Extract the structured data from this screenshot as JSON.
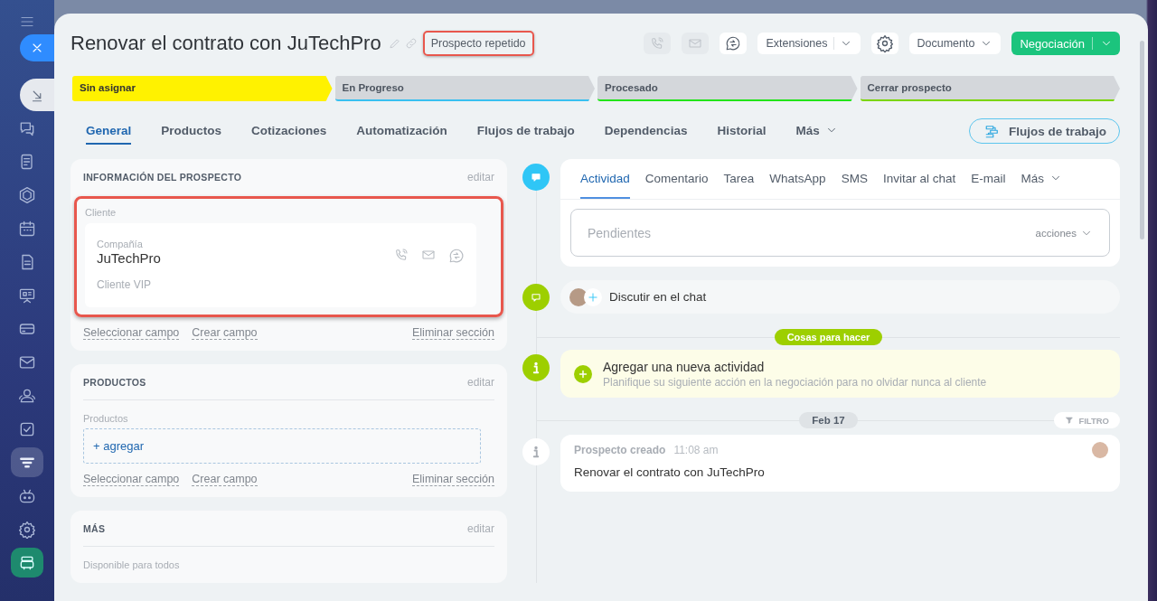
{
  "sidebar": {
    "items": [
      {
        "kind": "chat",
        "selected": false
      },
      {
        "kind": "news",
        "selected": false
      },
      {
        "kind": "hexagon",
        "selected": false
      },
      {
        "kind": "calendar",
        "selected": false
      },
      {
        "kind": "document",
        "selected": false
      },
      {
        "kind": "board",
        "selected": false
      },
      {
        "kind": "card",
        "selected": false
      },
      {
        "kind": "mail",
        "selected": false
      },
      {
        "kind": "people",
        "selected": false
      },
      {
        "kind": "check",
        "selected": false
      },
      {
        "kind": "filter",
        "selected": true
      },
      {
        "kind": "robot",
        "selected": false
      },
      {
        "kind": "gear",
        "selected": false
      }
    ]
  },
  "header": {
    "title": "Renovar el contrato con JuTechPro",
    "badge": "Prospecto repetido",
    "buttons": [
      {
        "kind": "phone",
        "disabled": true
      },
      {
        "kind": "mail",
        "disabled": true
      },
      {
        "kind": "chat",
        "disabled": false
      }
    ],
    "extensions": "Extensiones",
    "document": "Documento",
    "primary": "Negociación"
  },
  "stages": [
    {
      "label": "Sin asignar",
      "color": "#fff200",
      "selected": true
    },
    {
      "label": "En Progreso",
      "color": "#39c0f0",
      "selected": false
    },
    {
      "label": "Procesado",
      "color": "#22e41a",
      "selected": false
    },
    {
      "label": "Cerrar prospecto",
      "color": "#7bd500",
      "selected": false
    }
  ],
  "tabs": [
    {
      "label": "General",
      "selected": true
    },
    {
      "label": "Productos",
      "selected": false
    },
    {
      "label": "Cotizaciones",
      "selected": false
    },
    {
      "label": "Automatización",
      "selected": false
    },
    {
      "label": "Flujos de trabajo",
      "selected": false
    },
    {
      "label": "Dependencias",
      "selected": false
    },
    {
      "label": "Historial",
      "selected": false
    },
    {
      "label": "Más",
      "selected": false
    }
  ],
  "workflow_button": "Flujos de trabajo",
  "sections": [
    {
      "kind": "client",
      "title": "INFORMACIÓN DEL PROSPECTO",
      "edit": "editar",
      "field_label": "Cliente",
      "client": {
        "caption": "Compañía",
        "name": "JuTechPro",
        "note": "Cliente VIP"
      },
      "links": [
        "Seleccionar campo",
        "Crear campo"
      ],
      "remove": "Eliminar sección"
    },
    {
      "kind": "products",
      "title": "PRODUCTOS",
      "edit": "editar",
      "field_label": "Productos",
      "add": "+ agregar",
      "links": [
        "Seleccionar campo",
        "Crear campo"
      ],
      "remove": "Eliminar sección"
    },
    {
      "kind": "text",
      "title": "MÁS",
      "edit": "editar",
      "field_label": "Disponible para todos"
    }
  ],
  "activity": {
    "tabs": [
      {
        "label": "Actividad",
        "selected": true
      },
      {
        "label": "Comentario",
        "selected": false
      },
      {
        "label": "Tarea",
        "selected": false
      },
      {
        "label": "WhatsApp",
        "selected": false
      },
      {
        "label": "SMS",
        "selected": false
      },
      {
        "label": "Invitar al chat",
        "selected": false
      },
      {
        "label": "E-mail",
        "selected": false
      },
      {
        "label": "Más",
        "selected": false
      }
    ],
    "placeholder": "Pendientes",
    "actions": "acciones"
  },
  "chat": "Discutir en el chat",
  "todo_badge": "Cosas para hacer",
  "new_activity": {
    "title": "Agregar una nueva actividad",
    "subtitle": "Planifique su siguiente acción en la negociación para no olvidar nunca al cliente"
  },
  "date": "Feb 17",
  "filter": "FILTRO",
  "event": {
    "title": "Prospecto creado",
    "time": "11:08 am",
    "text": "Renovar el contrato con JuTechPro"
  }
}
